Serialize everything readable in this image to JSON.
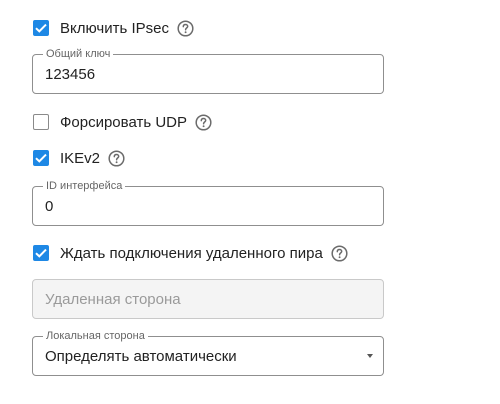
{
  "ipsec": {
    "enable_label": "Включить IPsec",
    "enable_checked": true,
    "psk_legend": "Общий ключ",
    "psk_value": "123456",
    "force_udp_label": "Форсировать UDP",
    "force_udp_checked": false,
    "ikev2_label": "IKEv2",
    "ikev2_checked": true,
    "interface_id_legend": "ID интерфейса",
    "interface_id_value": "0",
    "wait_peer_label": "Ждать подключения удаленного пира",
    "wait_peer_checked": true,
    "remote_side_placeholder": "Удаленная сторона",
    "local_side_legend": "Локальная сторона",
    "local_side_value": "Определять автоматически"
  },
  "colors": {
    "accent": "#1e88e5",
    "border": "#8f8f8f",
    "disabled_bg": "#f4f4f4"
  },
  "icons": {
    "help": "question-circle-icon",
    "check": "checkmark-icon",
    "dropdown": "caret-down-icon"
  }
}
